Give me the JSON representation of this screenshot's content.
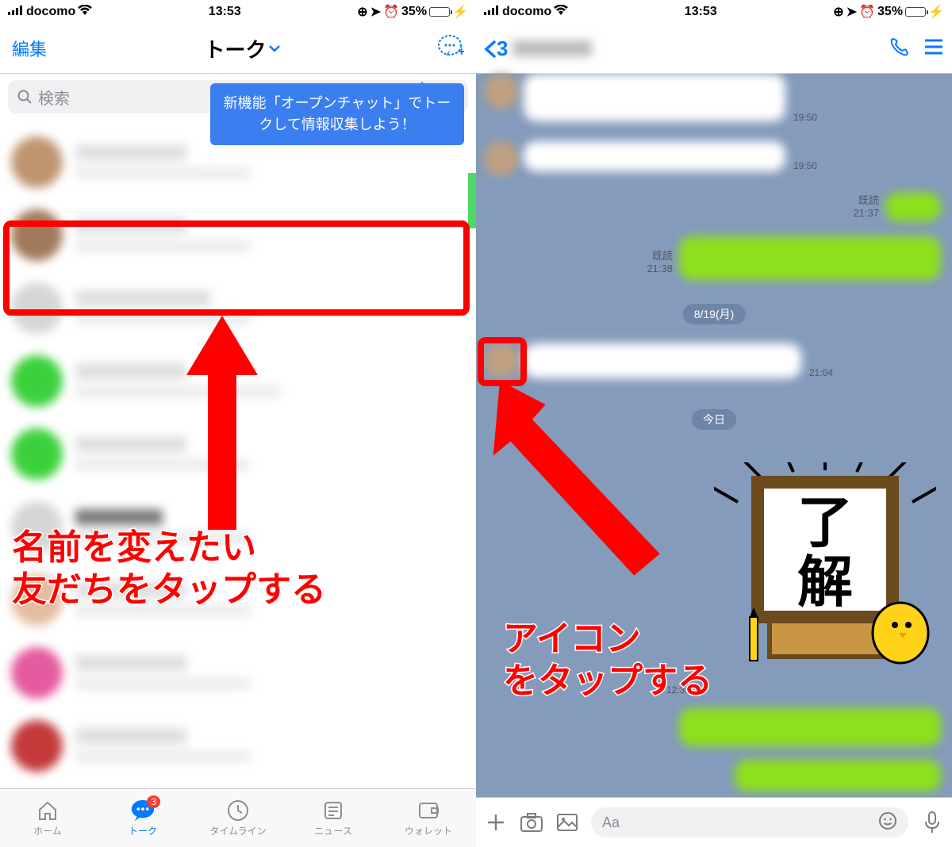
{
  "status": {
    "carrier": "docomo",
    "time": "13:53",
    "battery_pct": "35%"
  },
  "left": {
    "edit": "編集",
    "title": "トーク",
    "search_placeholder": "検索",
    "tooltip": "新機能「オープンチャット」でトークして情報収集しよう！",
    "tabs": {
      "home": "ホーム",
      "talk": "トーク",
      "timeline": "タイムライン",
      "news": "ニュース",
      "wallet": "ウォレット"
    },
    "badge": "3",
    "caption": "名前を変えたい\n友だちをタップする"
  },
  "right": {
    "back_count": "3",
    "times": {
      "t1": "19:50",
      "t2": "19:50",
      "t3": "21:37",
      "t4": "21:38",
      "t5": "21:04",
      "t6": "12:31"
    },
    "read": "既読",
    "date1": "8/19(月)",
    "date2": "今日",
    "sticker_text": "了解",
    "placeholder": "Aa",
    "caption": "アイコン\nをタップする"
  }
}
